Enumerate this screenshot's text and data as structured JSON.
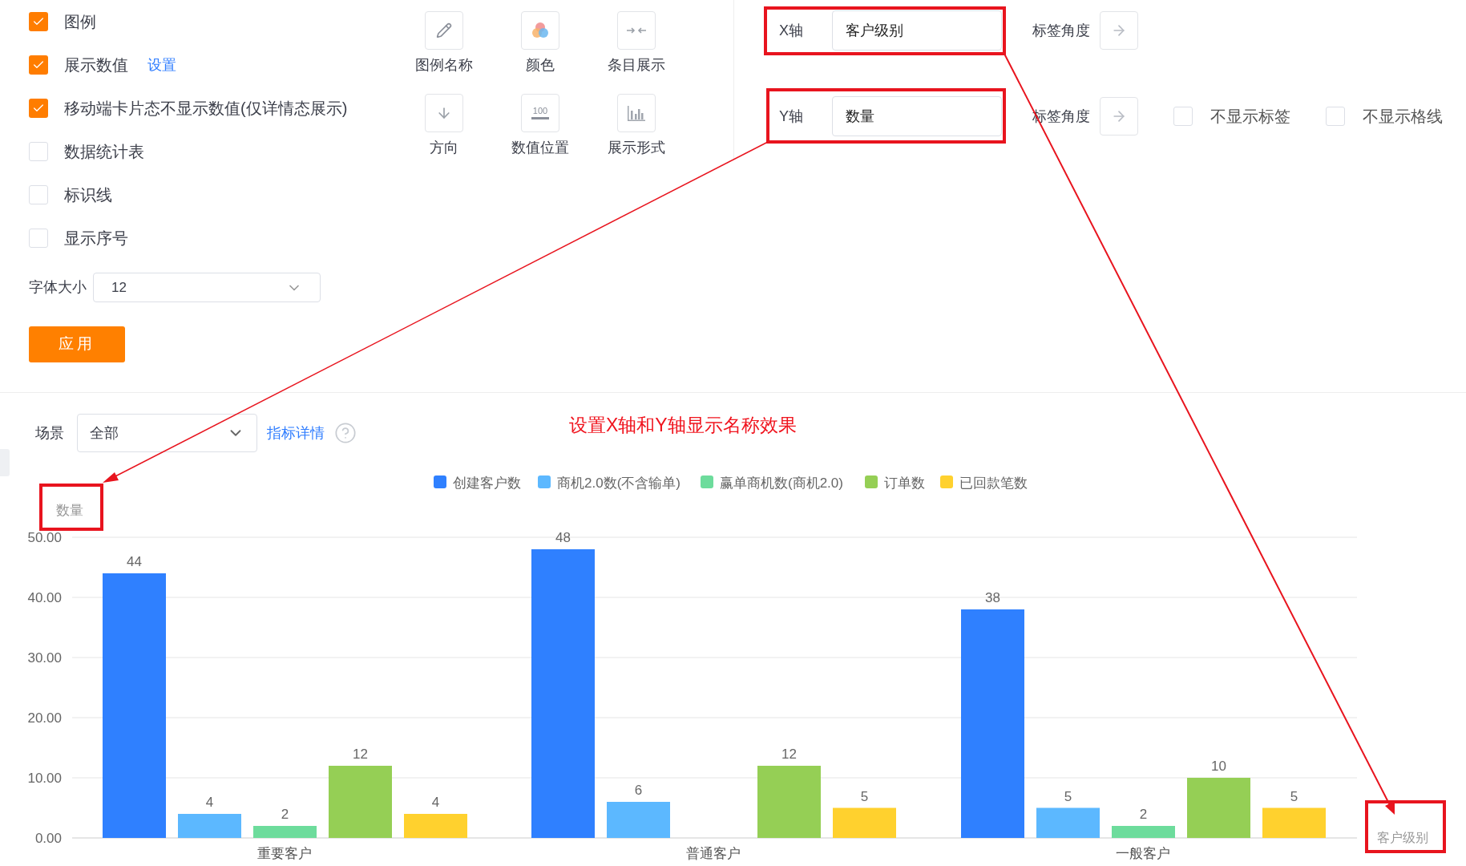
{
  "options": [
    {
      "label": "图例",
      "checked": true
    },
    {
      "label": "展示数值",
      "checked": true,
      "link": "设置"
    },
    {
      "label": "移动端卡片态不显示数值(仅详情态展示)",
      "checked": true
    },
    {
      "label": "数据统计表",
      "checked": false
    },
    {
      "label": "标识线",
      "checked": false
    },
    {
      "label": "显示序号",
      "checked": false
    }
  ],
  "font_size": {
    "label": "字体大小",
    "value": "12"
  },
  "apply_button": "应用",
  "style_tools": [
    {
      "label": "图例名称",
      "kind": "pencil"
    },
    {
      "label": "颜色",
      "kind": "palette"
    },
    {
      "label": "条目展示",
      "kind": "collapse"
    },
    {
      "label": "方向",
      "kind": "down"
    },
    {
      "label": "数值位置",
      "kind": "value",
      "icon_text": "100"
    },
    {
      "label": "展示形式",
      "kind": "bars"
    }
  ],
  "axes": [
    {
      "axis": "X轴",
      "value": "客户级别",
      "angle_label": "标签角度"
    },
    {
      "axis": "Y轴",
      "value": "数量",
      "angle_label": "标签角度",
      "options": [
        {
          "label": "不显示标签",
          "checked": false
        },
        {
          "label": "不显示格线",
          "checked": false
        }
      ]
    }
  ],
  "filter": {
    "label": "场景",
    "value": "全部",
    "link": "指标详情"
  },
  "annotation": "设置X轴和Y轴显示名称效果",
  "chart_data": {
    "type": "bar",
    "xlabel": "客户级别",
    "ylabel": "数量",
    "categories": [
      "重要客户",
      "普通客户",
      "一般客户"
    ],
    "series": [
      {
        "name": "创建客户数",
        "color": "#2f80ff",
        "values": [
          44,
          48,
          38
        ]
      },
      {
        "name": "商机2.0数(不含输单)",
        "color": "#5cb8ff",
        "values": [
          4,
          6,
          5
        ]
      },
      {
        "name": "赢单商机数(商机2.0)",
        "color": "#6ddc9c",
        "values": [
          2,
          null,
          2
        ]
      },
      {
        "name": "订单数",
        "color": "#95cf55",
        "values": [
          12,
          12,
          10
        ]
      },
      {
        "name": "已回款笔数",
        "color": "#ffd12e",
        "values": [
          4,
          5,
          5
        ]
      }
    ],
    "ylim": [
      0,
      50
    ],
    "yticks": [
      {
        "value": 0,
        "label": "0.00"
      },
      {
        "value": 10,
        "label": "10.00"
      },
      {
        "value": 20,
        "label": "20.00"
      },
      {
        "value": 30,
        "label": "30.00"
      },
      {
        "value": 40,
        "label": "40.00"
      },
      {
        "value": 50,
        "label": "50.00"
      }
    ],
    "data_labels": true,
    "grid": true,
    "legend": true
  }
}
